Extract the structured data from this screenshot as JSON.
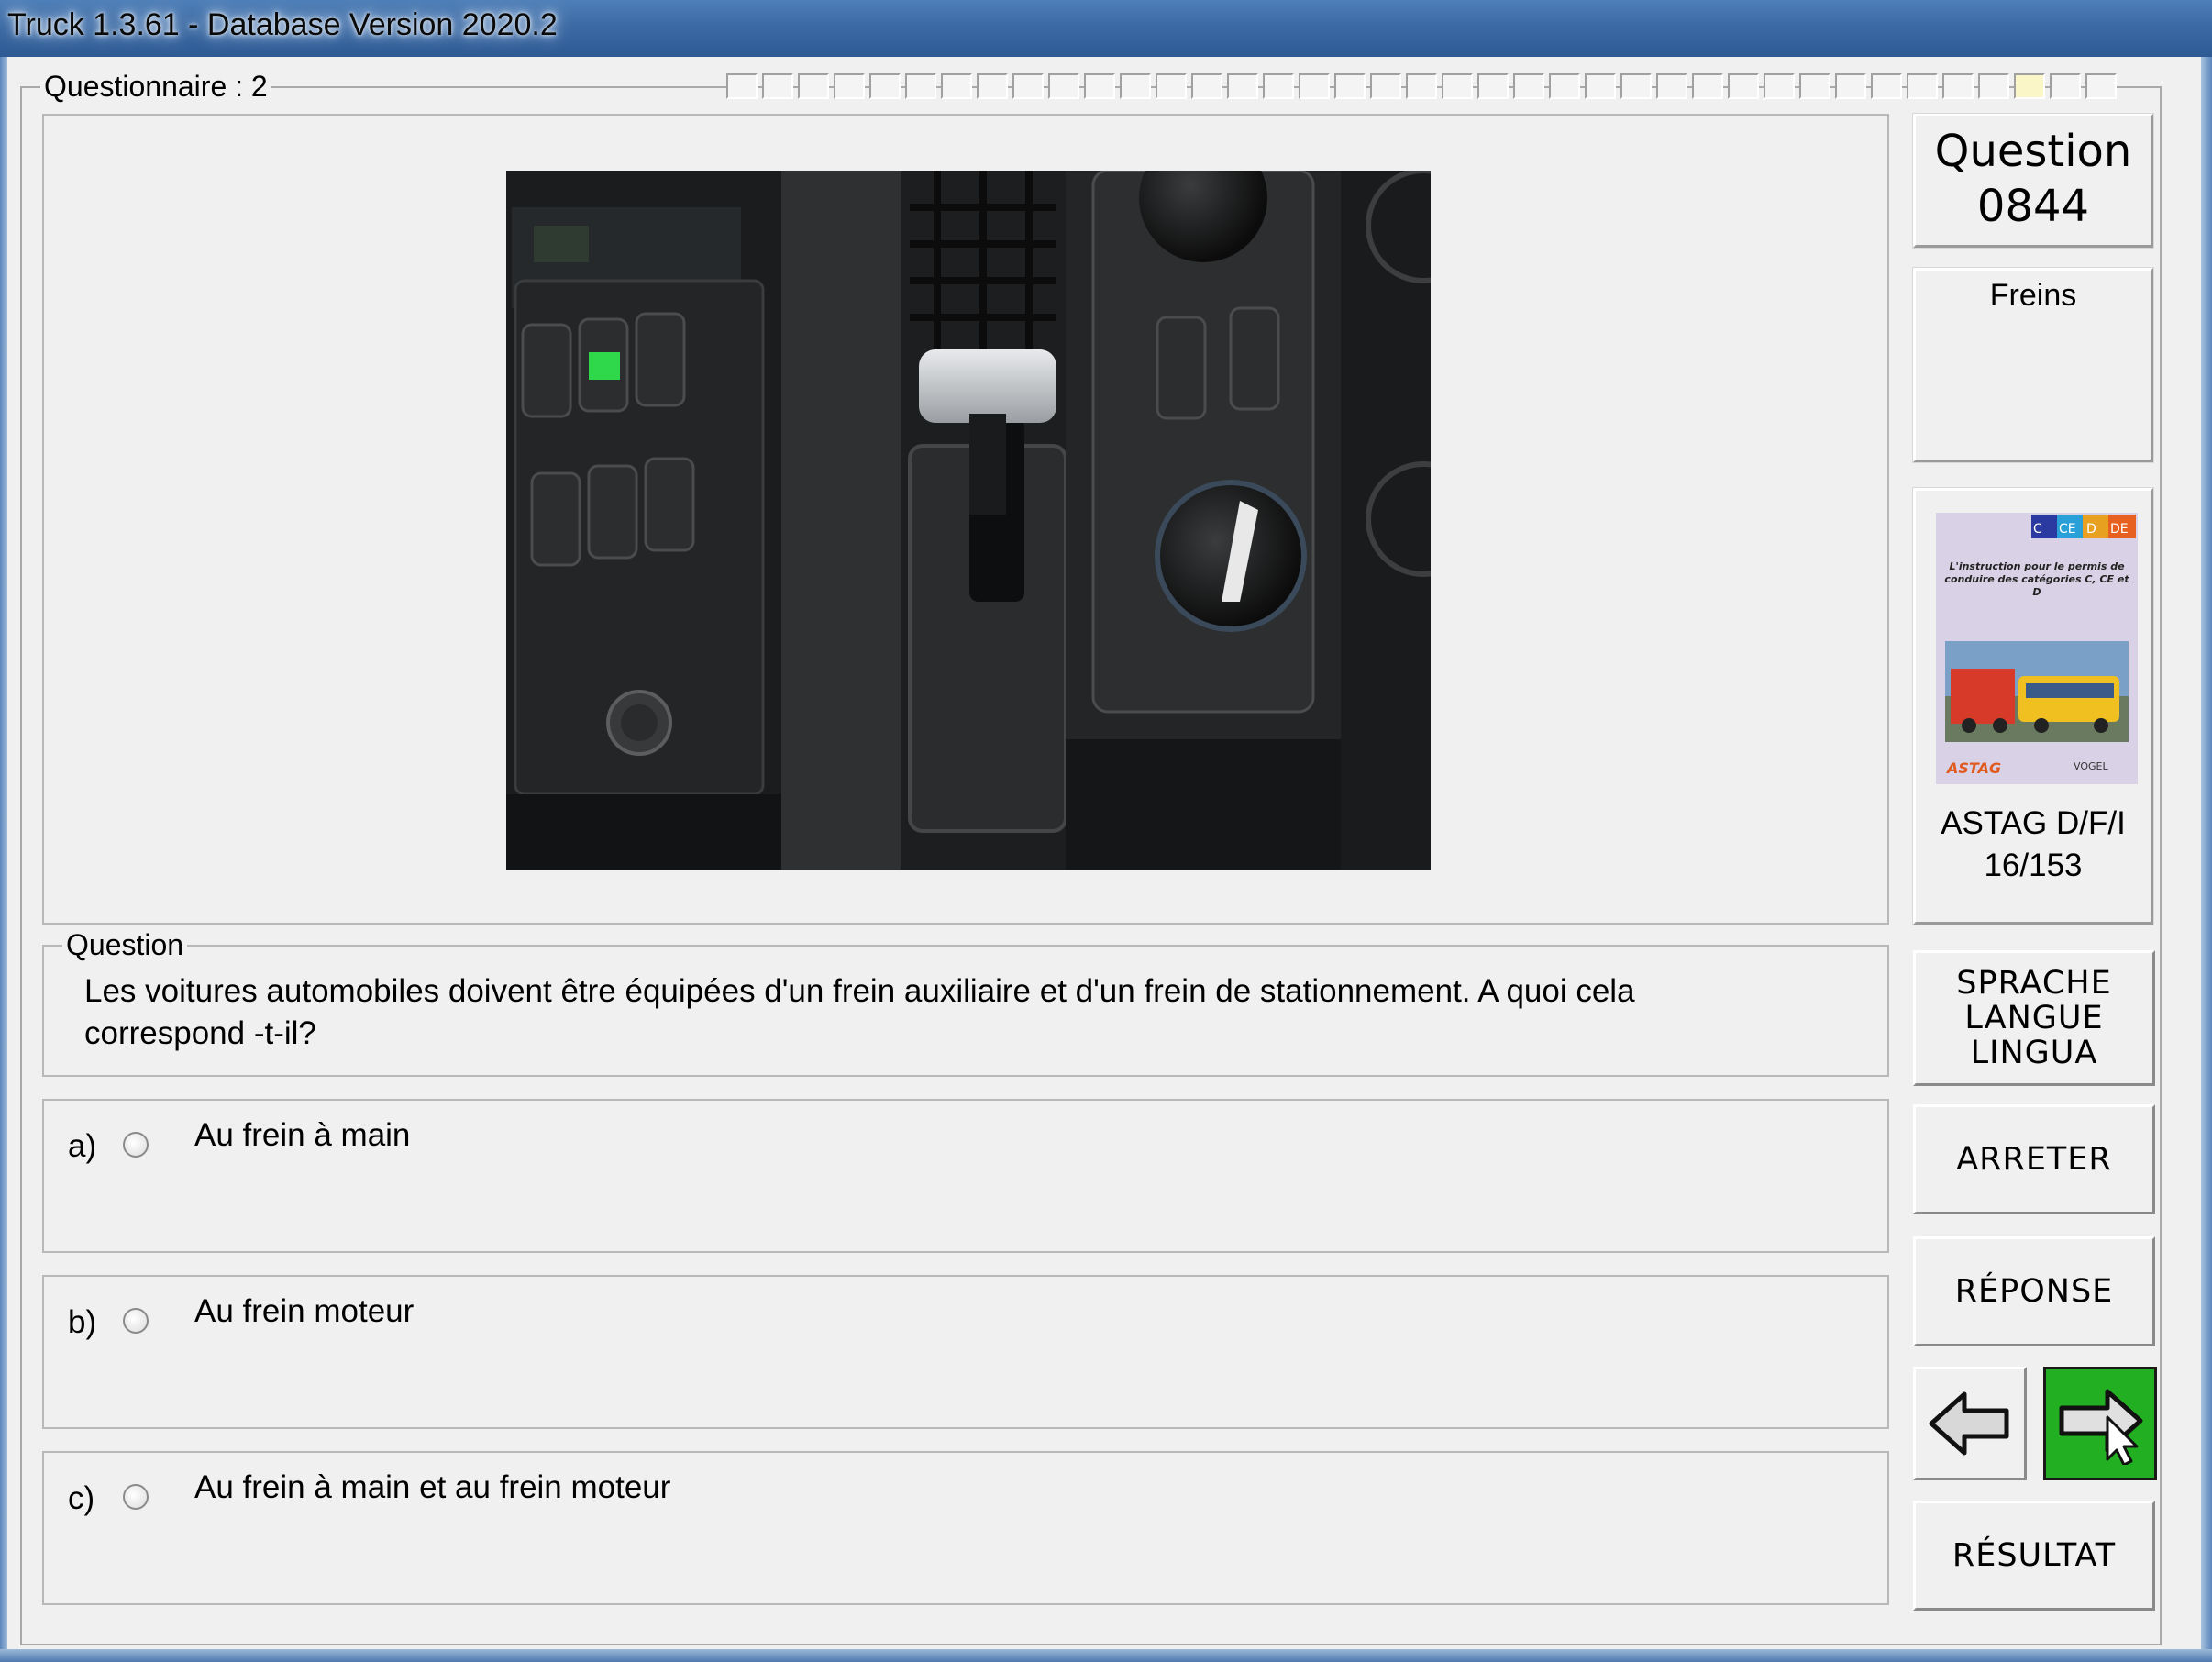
{
  "window": {
    "title": "Truck 1.3.61 - Database Version 2020.2"
  },
  "questionnaire": {
    "label": "Questionnaire : 2",
    "progress_cells": 39,
    "progress_current": 37
  },
  "question_panel": {
    "number_label": "Question",
    "number": "0844",
    "category": "Freins",
    "question_group_label": "Question",
    "question_text": "Les voitures automobiles doivent être équipées d'un frein auxiliaire et d'un frein de stationnement. A quoi cela correspond -t-il?"
  },
  "answers": [
    {
      "letter": "a)",
      "text": "Au frein à main"
    },
    {
      "letter": "b)",
      "text": "Au frein moteur"
    },
    {
      "letter": "c)",
      "text": "Au frein à main et au frein moteur"
    }
  ],
  "book": {
    "caption_line1": "ASTAG D/F/I",
    "caption_line2": "16/153",
    "cover_badges": [
      "C",
      "CE",
      "D",
      "DE"
    ],
    "cover_title": "L'instruction pour le permis de conduire des catégories C, CE et D",
    "cover_logo_left": "ASTAG",
    "cover_logo_right": "VOGEL"
  },
  "buttons": {
    "sprache_line1": "SPRACHE",
    "sprache_line2": "LANGUE",
    "sprache_line3": "LINGUA",
    "arreter": "ARRETER",
    "reponse": "RÉPONSE",
    "resultat": "RÉSULTAT"
  },
  "icons": {
    "prev": "left-arrow-icon",
    "next": "right-arrow-cursor-icon"
  },
  "colors": {
    "next_button_bg": "#22b022",
    "titlebar": "#3c6aa4"
  }
}
